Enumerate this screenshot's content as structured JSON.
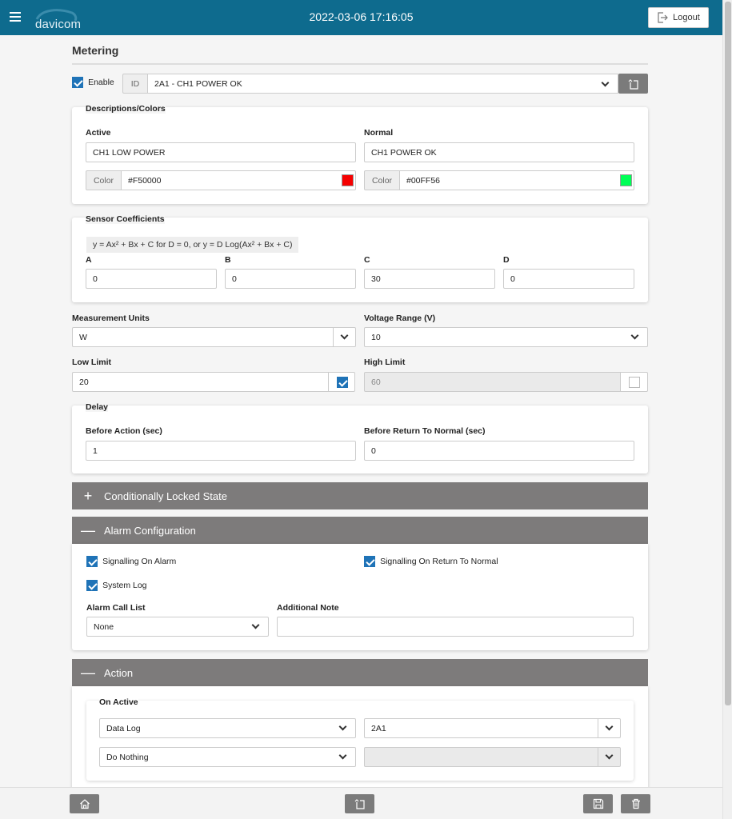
{
  "header": {
    "brand": "davicom",
    "datetime": "2022-03-06 17:16:05",
    "logout_label": "Logout",
    "bg_color": "#0e6b8e"
  },
  "page": {
    "title": "Metering",
    "enable_label": "Enable",
    "enable_checked": true,
    "id_prefix": "ID",
    "id_value": "2A1 - CH1 POWER OK"
  },
  "descriptions": {
    "title": "Descriptions/Colors",
    "active_label": "Active",
    "active_value": "CH1 LOW POWER",
    "normal_label": "Normal",
    "normal_value": "CH1 POWER OK",
    "color_prefix": "Color",
    "active_color": "#F50000",
    "normal_color": "#00FF56"
  },
  "sensor": {
    "title": "Sensor Coefficients",
    "formula": "y = Ax² + Bx + C for D = 0, or y = D Log(Ax² + Bx + C)",
    "coefficients": [
      {
        "label": "A",
        "value": "0"
      },
      {
        "label": "B",
        "value": "0"
      },
      {
        "label": "C",
        "value": "30"
      },
      {
        "label": "D",
        "value": "0"
      }
    ]
  },
  "measurement": {
    "units_label": "Measurement Units",
    "units_value": "W",
    "voltage_label": "Voltage Range (V)",
    "voltage_value": "10",
    "low_label": "Low Limit",
    "low_value": "20",
    "low_enabled": true,
    "high_label": "High Limit",
    "high_value": "60",
    "high_enabled": false
  },
  "delay": {
    "title": "Delay",
    "before_action_label": "Before Action (sec)",
    "before_action_value": "1",
    "before_return_label": "Before Return To Normal (sec)",
    "before_return_value": "0"
  },
  "sections": {
    "locked_label": "Conditionally Locked State",
    "locked_sign": "+",
    "alarm_label": "Alarm Configuration",
    "alarm_sign": "—",
    "action_label": "Action",
    "action_sign": "—"
  },
  "alarm": {
    "signalling_alarm": "Signalling On Alarm",
    "signalling_return": "Signalling On Return To Normal",
    "system_log": "System Log",
    "call_list_label": "Alarm Call List",
    "call_list_value": "None",
    "note_label": "Additional Note",
    "note_value": ""
  },
  "action": {
    "on_active_label": "On Active",
    "row1_action": "Data Log",
    "row1_target": "2A1",
    "row2_action": "Do Nothing",
    "row2_target": ""
  }
}
